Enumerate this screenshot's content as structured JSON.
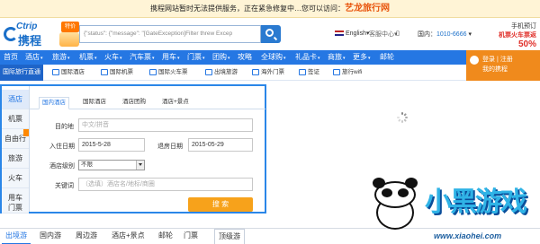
{
  "banner": {
    "text": "携程网站暂时无法提供服务，正在紧急修复中…您可以访问：",
    "link": "艺龙旅行网"
  },
  "header": {
    "logo_en": "Ctrip",
    "logo_cn": "携程",
    "promo_badge": "特价",
    "search_text": "{\"status\": {\"message\": \"[GateException]Filter threw Excep",
    "language": "English",
    "language_arrow": "▾",
    "customer_service": "客服中心",
    "customer_service_arrow": "▾",
    "mobile_label": "▯",
    "phone_prefix": "国内：",
    "phone": "1010-6666",
    "phone_arrow": "▾",
    "app_line1": "手机预订",
    "app_line2": "机票火车票返",
    "app_discount": "50%"
  },
  "nav": {
    "items": [
      "首页",
      "酒店",
      "旅游",
      "机票",
      "火车",
      "汽车票",
      "用车",
      "门票",
      "团购",
      "攻略",
      "全球购",
      "礼品卡",
      "商旅",
      "更多",
      "邮轮"
    ],
    "arrow": "▾",
    "login_line1": "登录 | 注册",
    "login_line2": "我的携程"
  },
  "subnav": {
    "intl_label": "国际旅行直通车",
    "items": [
      "国际酒店",
      "国际机票",
      "国际火车票",
      "出境旅游",
      "海外门票",
      "签证",
      "旅行wifi"
    ]
  },
  "booking": {
    "vtabs": [
      "酒店",
      "机票",
      "自由行",
      "旅游",
      "火车",
      "用车",
      "门票"
    ],
    "htabs": [
      "国内酒店",
      "国际酒店",
      "酒店团购",
      "酒店+景点"
    ],
    "destination_label": "目的地",
    "destination_placeholder": "中文/拼音",
    "checkin_label": "入住日期",
    "checkin_value": "2015-5-28",
    "checkout_label": "退房日期",
    "checkout_value": "2015-05-29",
    "level_label": "酒店级别",
    "level_value": "不限",
    "keyword_label": "关键词",
    "keyword_placeholder": "（选填）酒店名/地标/商圈",
    "search_button": "搜 索"
  },
  "bottom_tabs": [
    "出境游",
    "国内游",
    "周边游",
    "酒店+景点",
    "邮轮",
    "门票",
    "顶级游"
  ],
  "watermark": {
    "brand": "小黑游戏",
    "url": "www.xiaohei.com"
  },
  "colors": {
    "primary": "#2577e3",
    "orange": "#f7a21b",
    "banner_bg": "#fff4d6"
  }
}
